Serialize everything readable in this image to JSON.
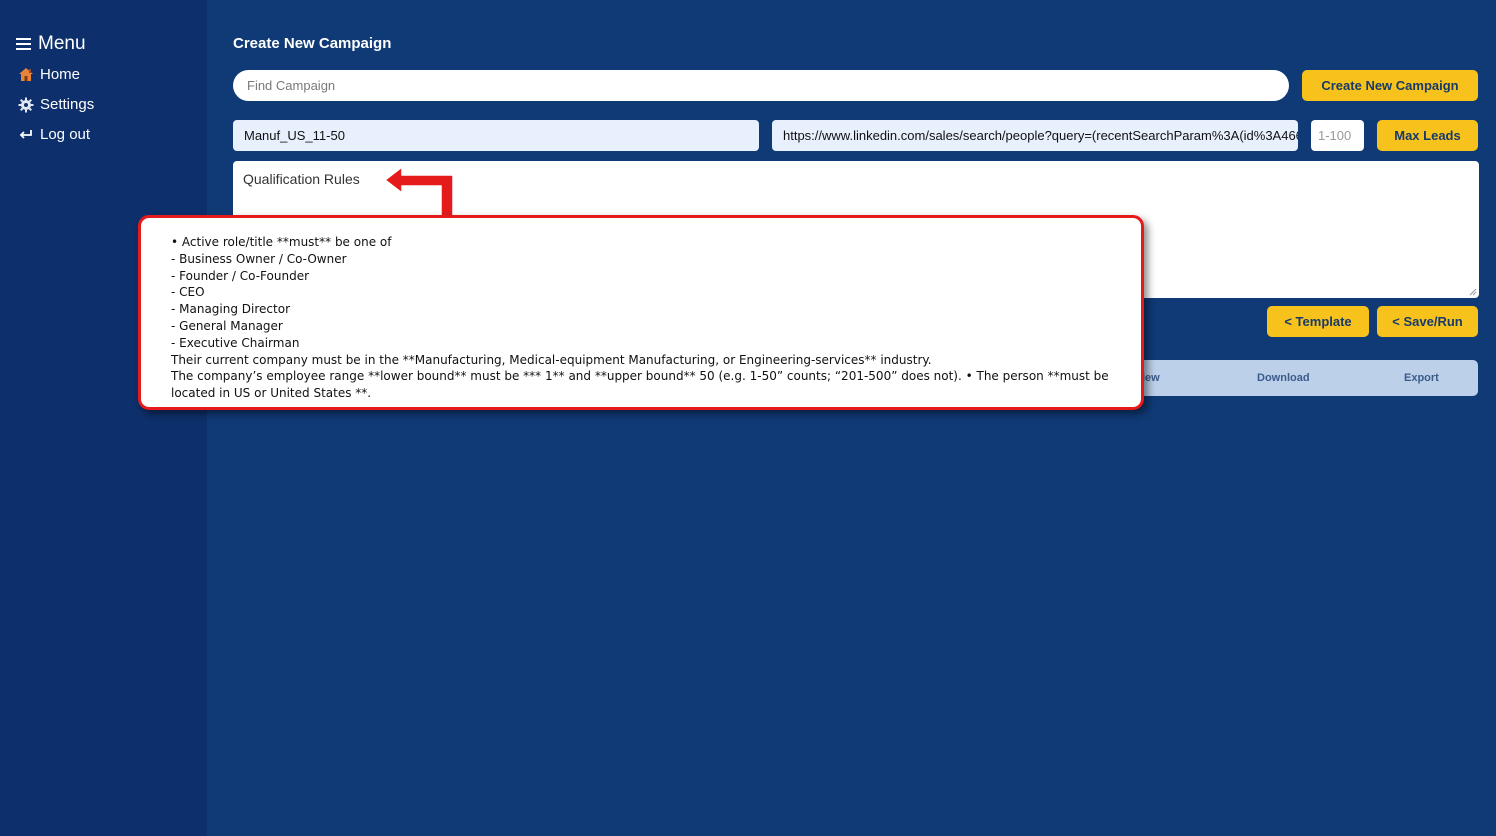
{
  "sidebar": {
    "menu_label": "Menu",
    "items": [
      {
        "label": "Home",
        "icon": "home-icon"
      },
      {
        "label": "Settings",
        "icon": "gear-icon"
      },
      {
        "label": "Log out",
        "icon": "logout-icon"
      }
    ]
  },
  "header": {
    "title": "Create New Campaign"
  },
  "search": {
    "placeholder": "Find Campaign"
  },
  "toolbar": {
    "create_label": "Create New Campaign",
    "max_leads_label": "Max Leads",
    "template_label": "< Template",
    "save_run_label": "< Save/Run"
  },
  "form": {
    "campaign_name": "Manuf_US_11-50",
    "search_url": "https://www.linkedin.com/sales/search/people?query=(recentSearchParam%3A(id%3A466",
    "leads_placeholder": "1-100",
    "rules_placeholder": "Qualification Rules"
  },
  "tabs": [
    "iew",
    "Download",
    "Export"
  ],
  "callout": {
    "lines": [
      "• Active role/title **must** be one of",
      "- Business Owner / Co-Owner",
      "- Founder / Co-Founder",
      "- CEO",
      "- Managing Director",
      "- General Manager",
      "- Executive Chairman",
      "Their current company must be in the **Manufacturing, Medical-equipment Manufacturing, or Engineering-services** industry.",
      "The company’s employee range **lower bound** must be *** 1** and **upper bound** 50 (e.g. 1-50” counts; “201-500” does not). • The person **must be located in US or United States **."
    ]
  },
  "colors": {
    "background": "#0f3a75",
    "sidebar": "#0d2f6b",
    "accent_yellow": "#f8c21c",
    "callout_border": "#e51b1b"
  }
}
